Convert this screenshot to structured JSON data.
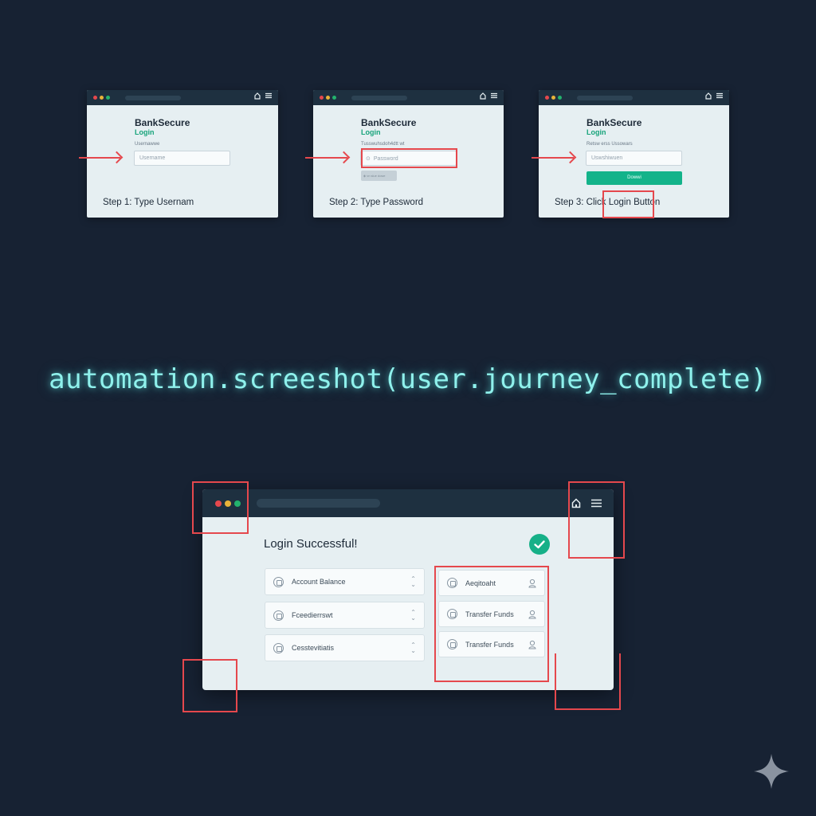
{
  "steps": [
    {
      "brand": "BankSecure",
      "login": "Login",
      "field_label": "Usernawwe",
      "field_placeholder": "Username",
      "caption": "Step 1: Type Usernam"
    },
    {
      "brand": "BankSecure",
      "login": "Login",
      "field_label": "Tusswuhsdoh4dtt wt",
      "field_placeholder": "Password",
      "show_label": "◈ vn slue dowe",
      "caption": "Step 2: Type Password"
    },
    {
      "brand": "BankSecure",
      "login": "Login",
      "field_label": "Retsw erss Ussowars",
      "field_placeholder": "Uswshiwuen",
      "button_label": "Dowwi",
      "caption": "Step 3: Click Login Button"
    }
  ],
  "code_line": "automation.screeshot(user.journey_complete)",
  "main": {
    "title": "Login Successful!",
    "left_cards": [
      "Account Balance",
      "Fceedierrswt",
      "Cesstevitiatis"
    ],
    "right_cards": [
      "Aeqitoaht",
      "Transfer Funds",
      "Transfer Funds"
    ]
  },
  "colors": {
    "background": "#172233",
    "titlebar": "#1e3040",
    "accent_green": "#16b088",
    "highlight_red": "#e5484d",
    "code_glow": "#8ff1ec"
  }
}
